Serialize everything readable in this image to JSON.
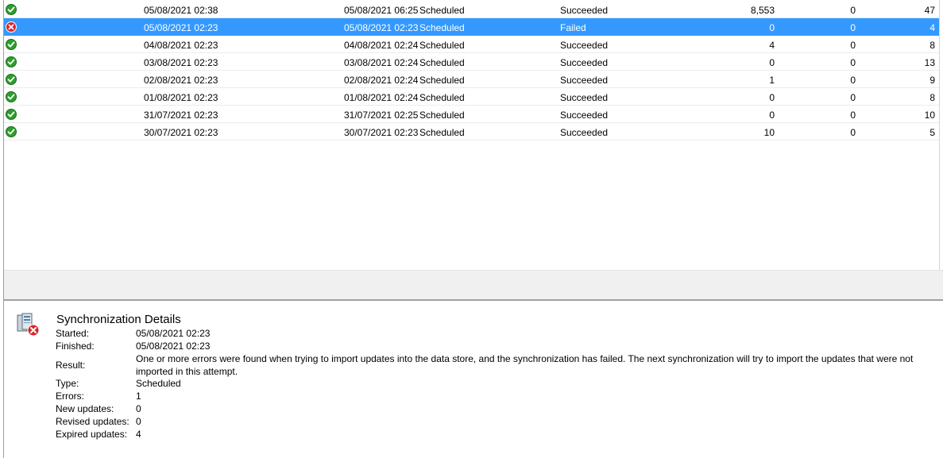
{
  "rows": [
    {
      "status": "success",
      "started": "05/08/2021 02:38",
      "finished": "05/08/2021 06:25",
      "type": "Scheduled",
      "result": "Succeeded",
      "new_updates": "8,553",
      "revised_updates": "0",
      "expired_updates": "47",
      "selected": false
    },
    {
      "status": "error",
      "started": "05/08/2021 02:23",
      "finished": "05/08/2021 02:23",
      "type": "Scheduled",
      "result": "Failed",
      "new_updates": "0",
      "revised_updates": "0",
      "expired_updates": "4",
      "selected": true
    },
    {
      "status": "success",
      "started": "04/08/2021 02:23",
      "finished": "04/08/2021 02:24",
      "type": "Scheduled",
      "result": "Succeeded",
      "new_updates": "4",
      "revised_updates": "0",
      "expired_updates": "8",
      "selected": false
    },
    {
      "status": "success",
      "started": "03/08/2021 02:23",
      "finished": "03/08/2021 02:24",
      "type": "Scheduled",
      "result": "Succeeded",
      "new_updates": "0",
      "revised_updates": "0",
      "expired_updates": "13",
      "selected": false
    },
    {
      "status": "success",
      "started": "02/08/2021 02:23",
      "finished": "02/08/2021 02:24",
      "type": "Scheduled",
      "result": "Succeeded",
      "new_updates": "1",
      "revised_updates": "0",
      "expired_updates": "9",
      "selected": false
    },
    {
      "status": "success",
      "started": "01/08/2021 02:23",
      "finished": "01/08/2021 02:24",
      "type": "Scheduled",
      "result": "Succeeded",
      "new_updates": "0",
      "revised_updates": "0",
      "expired_updates": "8",
      "selected": false
    },
    {
      "status": "success",
      "started": "31/07/2021 02:23",
      "finished": "31/07/2021 02:25",
      "type": "Scheduled",
      "result": "Succeeded",
      "new_updates": "0",
      "revised_updates": "0",
      "expired_updates": "10",
      "selected": false
    },
    {
      "status": "success",
      "started": "30/07/2021 02:23",
      "finished": "30/07/2021 02:23",
      "type": "Scheduled",
      "result": "Succeeded",
      "new_updates": "10",
      "revised_updates": "0",
      "expired_updates": "5",
      "selected": false
    }
  ],
  "details": {
    "title": "Synchronization Details",
    "icon": "server-error-icon",
    "fields": [
      {
        "label": "Started:",
        "value": "05/08/2021 02:23"
      },
      {
        "label": "Finished:",
        "value": "05/08/2021 02:23"
      },
      {
        "label": "Result:",
        "value": "One or more errors were found when trying to import updates into the data store, and the synchronization has failed. The next synchronization will try to import the updates that were not imported in this attempt."
      },
      {
        "label": "Type:",
        "value": "Scheduled"
      },
      {
        "label": "Errors:",
        "value": "1"
      },
      {
        "label": "New updates:",
        "value": "0"
      },
      {
        "label": "Revised updates:",
        "value": "0"
      },
      {
        "label": "Expired updates:",
        "value": "4"
      }
    ]
  },
  "colors": {
    "selection": "#3399ff",
    "success": "#2e9e2e",
    "error": "#d9262c"
  }
}
